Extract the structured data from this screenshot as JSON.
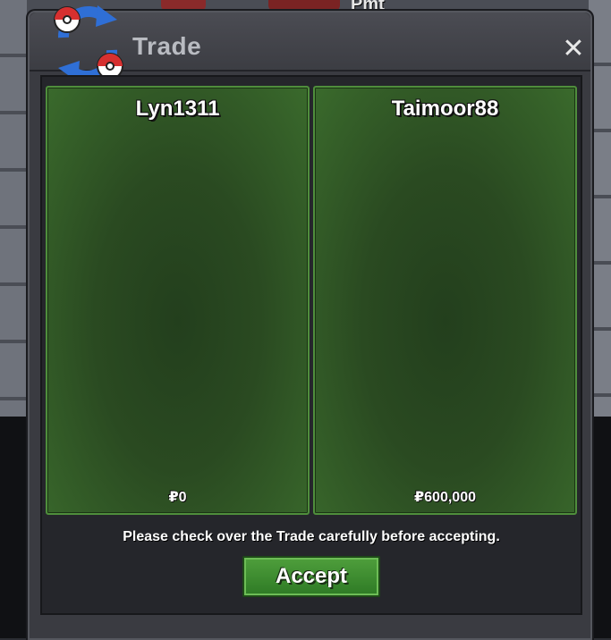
{
  "world": {
    "overhead_name": "Pmt"
  },
  "window": {
    "title": "Trade",
    "close_symbol": "✕",
    "icon": "trade-swap-icon"
  },
  "players": [
    {
      "name": "Lyn1311",
      "money": "₽0"
    },
    {
      "name": "Taimoor88",
      "money": "₽600,000"
    }
  ],
  "notice": "Please check over the Trade carefully before accepting.",
  "accept_label": "Accept",
  "colors": {
    "panel_green": "#2a4a21",
    "panel_border": "#4f8e3c",
    "accept_green": "#3e8d30",
    "window_bg": "#3a3b41"
  }
}
